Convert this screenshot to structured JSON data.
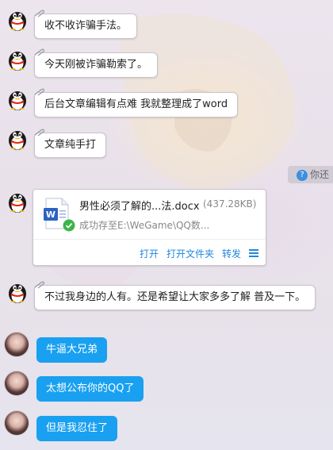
{
  "messages": [
    {
      "text": "收不收诈骗手法。"
    },
    {
      "text": "今天刚被诈骗勒索了。"
    },
    {
      "text": "后台文章编辑有点难 我就整理成了word"
    },
    {
      "text": "文章纯手打"
    },
    {
      "text": "不过我身边的人有。还是希望让大家多多了解 普及一下。"
    }
  ],
  "file": {
    "name": "男性必须了解的...法.docx",
    "size": "(437.28KB)",
    "status": "成功存至E:\\WeGame\\QQ数...",
    "open": "打开",
    "open_folder": "打开文件夹",
    "forward": "转发",
    "icon": "word-doc-icon"
  },
  "user_messages": [
    {
      "text": "牛逼大兄弟"
    },
    {
      "text": "太想公布你的QQ了"
    },
    {
      "text": "但是我忍住了"
    }
  ],
  "notice": {
    "text": "你还"
  },
  "colors": {
    "user_bubble": "#19a0f0",
    "link": "#1e87e0",
    "bubble_border": "#c9c3cc"
  }
}
